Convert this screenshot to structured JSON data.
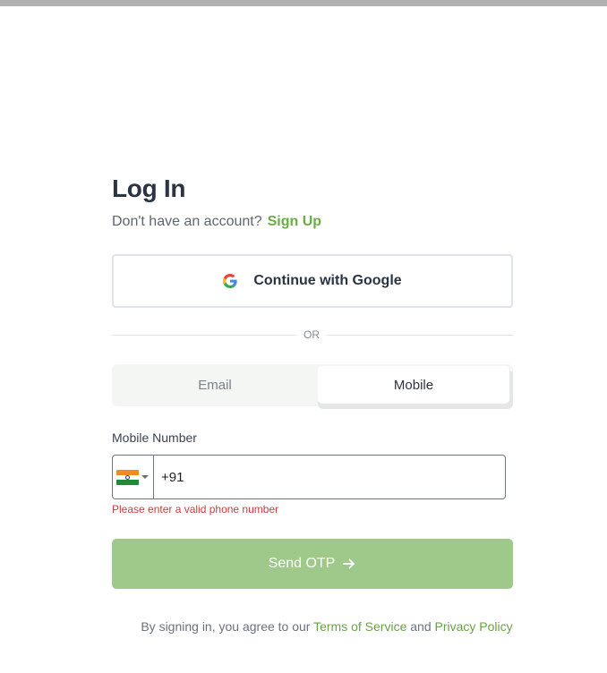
{
  "header": {
    "title": "Log In"
  },
  "signup": {
    "prompt": "Don't have an account?",
    "link": "Sign Up"
  },
  "google": {
    "label": "Continue with Google",
    "icon": "google-icon"
  },
  "divider": {
    "text": "OR"
  },
  "tabs": [
    {
      "label": "Email",
      "active": false
    },
    {
      "label": "Mobile",
      "active": true
    }
  ],
  "mobile": {
    "label": "Mobile Number",
    "country_flag": "india-flag-icon",
    "value": "+91",
    "error": "Please enter a valid phone number"
  },
  "submit": {
    "label": "Send OTP",
    "icon": "arrow-right-icon"
  },
  "terms": {
    "prefix": "By signing in, you agree to our",
    "tos": "Terms of Service",
    "and": "and",
    "privacy": "Privacy Policy"
  },
  "colors": {
    "accent": "#6aad45",
    "button_disabled": "#9ec98a",
    "error": "#d0393c",
    "topbar": "#b1b1b1"
  }
}
